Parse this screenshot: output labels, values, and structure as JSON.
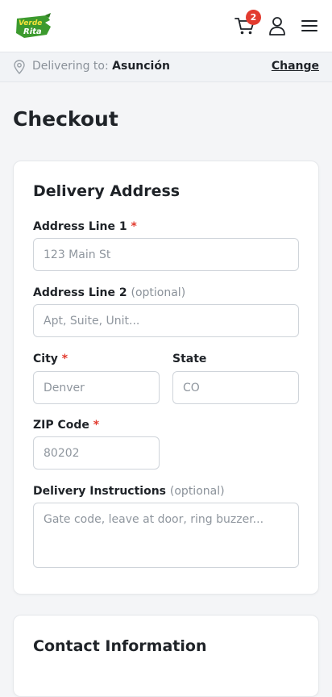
{
  "header": {
    "logo_icon": "verde-rita-logo",
    "cart_count": "2",
    "brand_green": "#3c9a2e",
    "badge_color": "#e23b2f"
  },
  "delivery_bar": {
    "prefix": "Delivering to:",
    "city": "Asunción",
    "change_label": "Change"
  },
  "page": {
    "title": "Checkout"
  },
  "delivery_address": {
    "title": "Delivery Address",
    "address1": {
      "label": "Address Line 1",
      "required_mark": "*",
      "placeholder": "123 Main St"
    },
    "address2": {
      "label": "Address Line 2",
      "optional": "(optional)",
      "placeholder": "Apt, Suite, Unit..."
    },
    "city": {
      "label": "City",
      "required_mark": "*",
      "placeholder": "Denver"
    },
    "state": {
      "label": "State",
      "placeholder": "CO"
    },
    "zip": {
      "label": "ZIP Code",
      "required_mark": "*",
      "placeholder": "80202"
    },
    "instructions": {
      "label": "Delivery Instructions",
      "optional": "(optional)",
      "placeholder": "Gate code, leave at door, ring buzzer..."
    }
  },
  "contact_info": {
    "title": "Contact Information"
  }
}
